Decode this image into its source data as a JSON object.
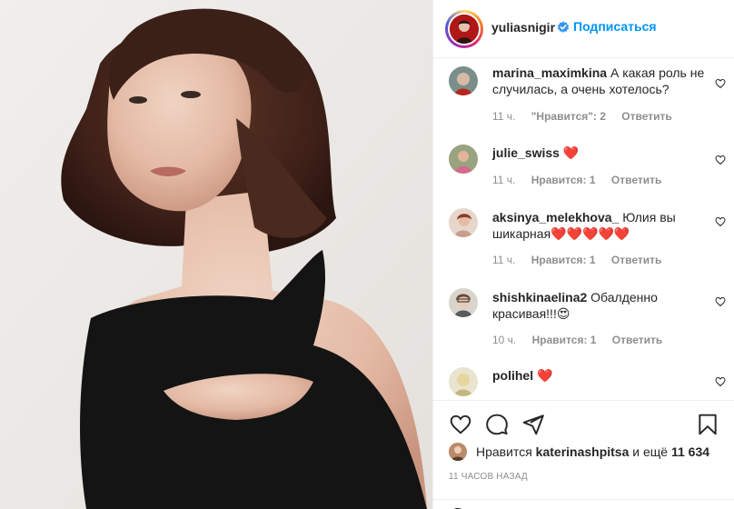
{
  "header": {
    "username": "yuliasnigir",
    "follow_label": "Подписаться",
    "verified_icon": "verified-badge-icon",
    "accent_color": "#0095f6"
  },
  "comments": [
    {
      "user": "marina_maximkina",
      "text": "А какая роль не случилась, а очень хотелось?",
      "time": "11 ч.",
      "likes": "\"Нравится\": 2",
      "reply": "Ответить"
    },
    {
      "user": "julie_swiss",
      "text": "❤️",
      "time": "11 ч.",
      "likes": "Нравится: 1",
      "reply": "Ответить"
    },
    {
      "user": "aksinya_melekhova_",
      "text": "Юлия вы шикарная❤️❤️❤️❤️❤️",
      "time": "11 ч.",
      "likes": "Нравится: 1",
      "reply": "Ответить"
    },
    {
      "user": "shishkinaelina2",
      "text": "Обалденно красивая!!!😍",
      "time": "10 ч.",
      "likes": "Нравится: 1",
      "reply": "Ответить"
    },
    {
      "user": "polihel",
      "text": "❤️"
    }
  ],
  "likes_row": {
    "prefix": "Нравится",
    "user": "katerinashpitsa",
    "middle": "и ещё",
    "count": "11 634"
  },
  "timestamp": "11 часов назад",
  "icons": {
    "like": "heart-outline-icon",
    "comment": "comment-bubble-icon",
    "share": "paper-plane-icon",
    "save": "bookmark-icon"
  }
}
